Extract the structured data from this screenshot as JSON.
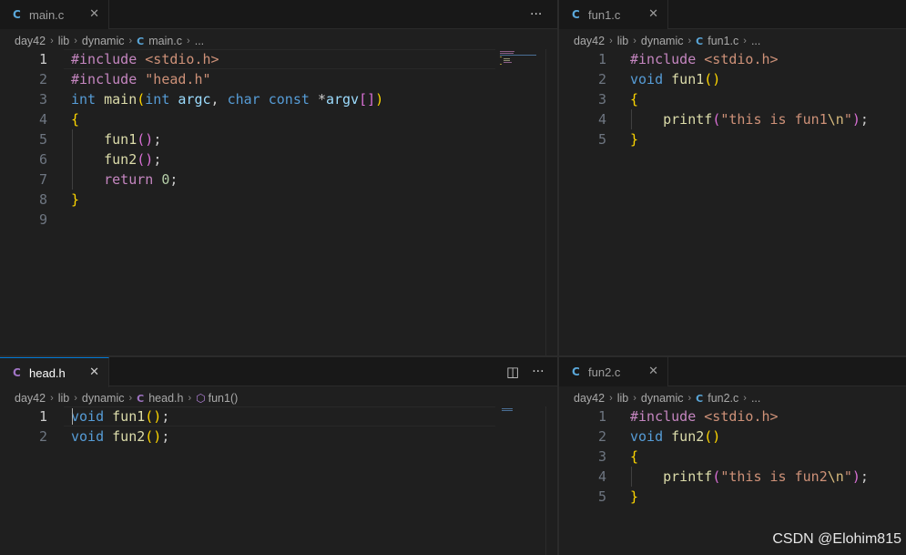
{
  "colors": {
    "background": "#1f1f1f",
    "tab_active_border": "#0078d4",
    "keyword": "#569cd6",
    "preprocessor": "#c586c0",
    "function": "#dcdcaa",
    "string": "#ce9178"
  },
  "actions": {
    "more": "···",
    "split": "◫"
  },
  "panes": {
    "main": {
      "tab": {
        "icon": "C",
        "label": "main.c",
        "close": "✕"
      },
      "breadcrumb": [
        "day42",
        "lib",
        "dynamic",
        "main.c",
        "..."
      ],
      "lines": [
        {
          "n": "1",
          "tokens": [
            [
              "kp",
              "#include "
            ],
            [
              "st",
              "<stdio.h>"
            ]
          ]
        },
        {
          "n": "2",
          "tokens": [
            [
              "kp",
              "#include "
            ],
            [
              "st",
              "\"head.h\""
            ]
          ]
        },
        {
          "n": "3",
          "tokens": [
            [
              "kw",
              "int "
            ],
            [
              "fn",
              "main"
            ],
            [
              "b1",
              "("
            ],
            [
              "kw",
              "int "
            ],
            [
              "pm",
              "argc"
            ],
            [
              "pl",
              ", "
            ],
            [
              "kw",
              "char const "
            ],
            [
              "pl",
              "*"
            ],
            [
              "pm",
              "argv"
            ],
            [
              "b2",
              "[]"
            ],
            [
              "b1",
              ")"
            ]
          ]
        },
        {
          "n": "4",
          "tokens": [
            [
              "b1",
              "{"
            ]
          ]
        },
        {
          "n": "5",
          "tokens": [
            [
              "pl",
              "    "
            ],
            [
              "fn",
              "fun1"
            ],
            [
              "b2",
              "()"
            ],
            [
              "pl",
              ";"
            ]
          ]
        },
        {
          "n": "6",
          "tokens": [
            [
              "pl",
              "    "
            ],
            [
              "fn",
              "fun2"
            ],
            [
              "b2",
              "()"
            ],
            [
              "pl",
              ";"
            ]
          ]
        },
        {
          "n": "7",
          "tokens": [
            [
              "pl",
              "    "
            ],
            [
              "kp",
              "return "
            ],
            [
              "nm",
              "0"
            ],
            [
              "pl",
              ";"
            ]
          ]
        },
        {
          "n": "8",
          "tokens": [
            [
              "b1",
              "}"
            ]
          ]
        },
        {
          "n": "9",
          "tokens": []
        }
      ]
    },
    "fun1": {
      "tab": {
        "icon": "C",
        "label": "fun1.c",
        "close": "✕"
      },
      "breadcrumb": [
        "day42",
        "lib",
        "dynamic",
        "fun1.c",
        "..."
      ],
      "lines": [
        {
          "n": "1",
          "tokens": [
            [
              "kp",
              "#include "
            ],
            [
              "st",
              "<stdio.h>"
            ]
          ]
        },
        {
          "n": "2",
          "tokens": [
            [
              "kw",
              "void "
            ],
            [
              "fn",
              "fun1"
            ],
            [
              "b1",
              "()"
            ]
          ]
        },
        {
          "n": "3",
          "tokens": [
            [
              "b1",
              "{"
            ]
          ]
        },
        {
          "n": "4",
          "tokens": [
            [
              "pl",
              "    "
            ],
            [
              "fn",
              "printf"
            ],
            [
              "b2",
              "("
            ],
            [
              "st",
              "\"this is fun1"
            ],
            [
              "es",
              "\\n"
            ],
            [
              "st",
              "\""
            ],
            [
              "b2",
              ")"
            ],
            [
              "pl",
              ";"
            ]
          ]
        },
        {
          "n": "5",
          "tokens": [
            [
              "b1",
              "}"
            ]
          ]
        }
      ]
    },
    "head": {
      "tab": {
        "icon": "C",
        "label": "head.h",
        "close": "✕"
      },
      "breadcrumb": [
        "day42",
        "lib",
        "dynamic",
        "head.h",
        "fun1()"
      ],
      "lines": [
        {
          "n": "1",
          "tokens": [
            [
              "kw",
              "void "
            ],
            [
              "fn",
              "fun1"
            ],
            [
              "b1",
              "()"
            ],
            [
              "pl",
              ";"
            ]
          ]
        },
        {
          "n": "2",
          "tokens": [
            [
              "kw",
              "void "
            ],
            [
              "fn",
              "fun2"
            ],
            [
              "b1",
              "()"
            ],
            [
              "pl",
              ";"
            ]
          ]
        }
      ]
    },
    "fun2": {
      "tab": {
        "icon": "C",
        "label": "fun2.c",
        "close": "✕"
      },
      "breadcrumb": [
        "day42",
        "lib",
        "dynamic",
        "fun2.c",
        "..."
      ],
      "lines": [
        {
          "n": "1",
          "tokens": [
            [
              "kp",
              "#include "
            ],
            [
              "st",
              "<stdio.h>"
            ]
          ]
        },
        {
          "n": "2",
          "tokens": [
            [
              "kw",
              "void "
            ],
            [
              "fn",
              "fun2"
            ],
            [
              "b1",
              "()"
            ]
          ]
        },
        {
          "n": "3",
          "tokens": [
            [
              "b1",
              "{"
            ]
          ]
        },
        {
          "n": "4",
          "tokens": [
            [
              "pl",
              "    "
            ],
            [
              "fn",
              "printf"
            ],
            [
              "b2",
              "("
            ],
            [
              "st",
              "\"this is fun2"
            ],
            [
              "es",
              "\\n"
            ],
            [
              "st",
              "\""
            ],
            [
              "b2",
              ")"
            ],
            [
              "pl",
              ";"
            ]
          ]
        },
        {
          "n": "5",
          "tokens": [
            [
              "b1",
              "}"
            ]
          ]
        }
      ]
    }
  },
  "watermark": "CSDN @Elohim815"
}
